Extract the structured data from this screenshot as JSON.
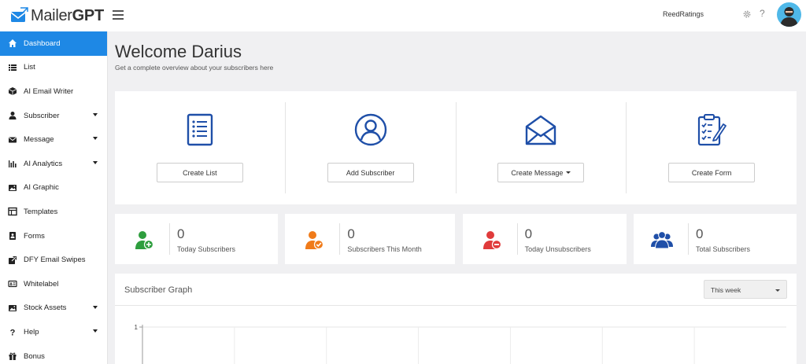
{
  "brand": {
    "name_light": "Mailer",
    "name_bold": "GPT",
    "accent": "#1e88e5"
  },
  "topbar": {
    "account_name": "ReedRatings",
    "settings_icon": "gear-icon",
    "help_icon": "question-icon",
    "help_glyph": "?"
  },
  "sidebar": {
    "items": [
      {
        "label": "Dashboard",
        "icon": "home-icon",
        "active": true,
        "caret": false
      },
      {
        "label": "List",
        "icon": "list-icon",
        "active": false,
        "caret": false
      },
      {
        "label": "AI Email Writer",
        "icon": "cube-icon",
        "active": false,
        "caret": false
      },
      {
        "label": "Subscriber",
        "icon": "user-icon",
        "active": false,
        "caret": true
      },
      {
        "label": "Message",
        "icon": "envelope-icon",
        "active": false,
        "caret": true
      },
      {
        "label": "AI Analytics",
        "icon": "bar-chart-icon",
        "active": false,
        "caret": true
      },
      {
        "label": "AI Graphic",
        "icon": "image-icon",
        "active": false,
        "caret": false
      },
      {
        "label": "Templates",
        "icon": "template-icon",
        "active": false,
        "caret": false
      },
      {
        "label": "Forms",
        "icon": "form-icon",
        "active": false,
        "caret": false
      },
      {
        "label": "DFY Email Swipes",
        "icon": "external-link-icon",
        "active": false,
        "caret": false
      },
      {
        "label": "Whitelabel",
        "icon": "id-card-icon",
        "active": false,
        "caret": false
      },
      {
        "label": "Stock Assets",
        "icon": "image-icon",
        "active": false,
        "caret": true
      },
      {
        "label": "Help",
        "icon": "question-icon",
        "active": false,
        "caret": true
      },
      {
        "label": "Bonus",
        "icon": "gift-icon",
        "active": false,
        "caret": false
      }
    ]
  },
  "main": {
    "welcome": "Welcome Darius",
    "subtitle": "Get a complete overview about your subscribers here",
    "actions": [
      {
        "label": "Create List",
        "icon": "list-document-icon",
        "dropdown": false
      },
      {
        "label": "Add Subscriber",
        "icon": "user-circle-icon",
        "dropdown": false
      },
      {
        "label": "Create Message",
        "icon": "open-envelope-icon",
        "dropdown": true
      },
      {
        "label": "Create Form",
        "icon": "clipboard-icon",
        "dropdown": false
      }
    ],
    "stats": [
      {
        "value": "0",
        "label": "Today Subscribers",
        "icon": "user-add-icon",
        "color": "#2e9e3e"
      },
      {
        "value": "0",
        "label": "Subscribers This Month",
        "icon": "user-check-icon",
        "color": "#f07b1a"
      },
      {
        "value": "0",
        "label": "Today Unsubscribers",
        "icon": "user-remove-icon",
        "color": "#e03b3b"
      },
      {
        "value": "0",
        "label": "Total Subscribers",
        "icon": "users-icon",
        "color": "#1f4fa8"
      }
    ],
    "graph": {
      "title": "Subscriber Graph",
      "period": "This week"
    }
  },
  "chart_data": {
    "type": "line",
    "title": "",
    "ytick_labels": [
      "1"
    ],
    "series": [],
    "grid": true
  }
}
